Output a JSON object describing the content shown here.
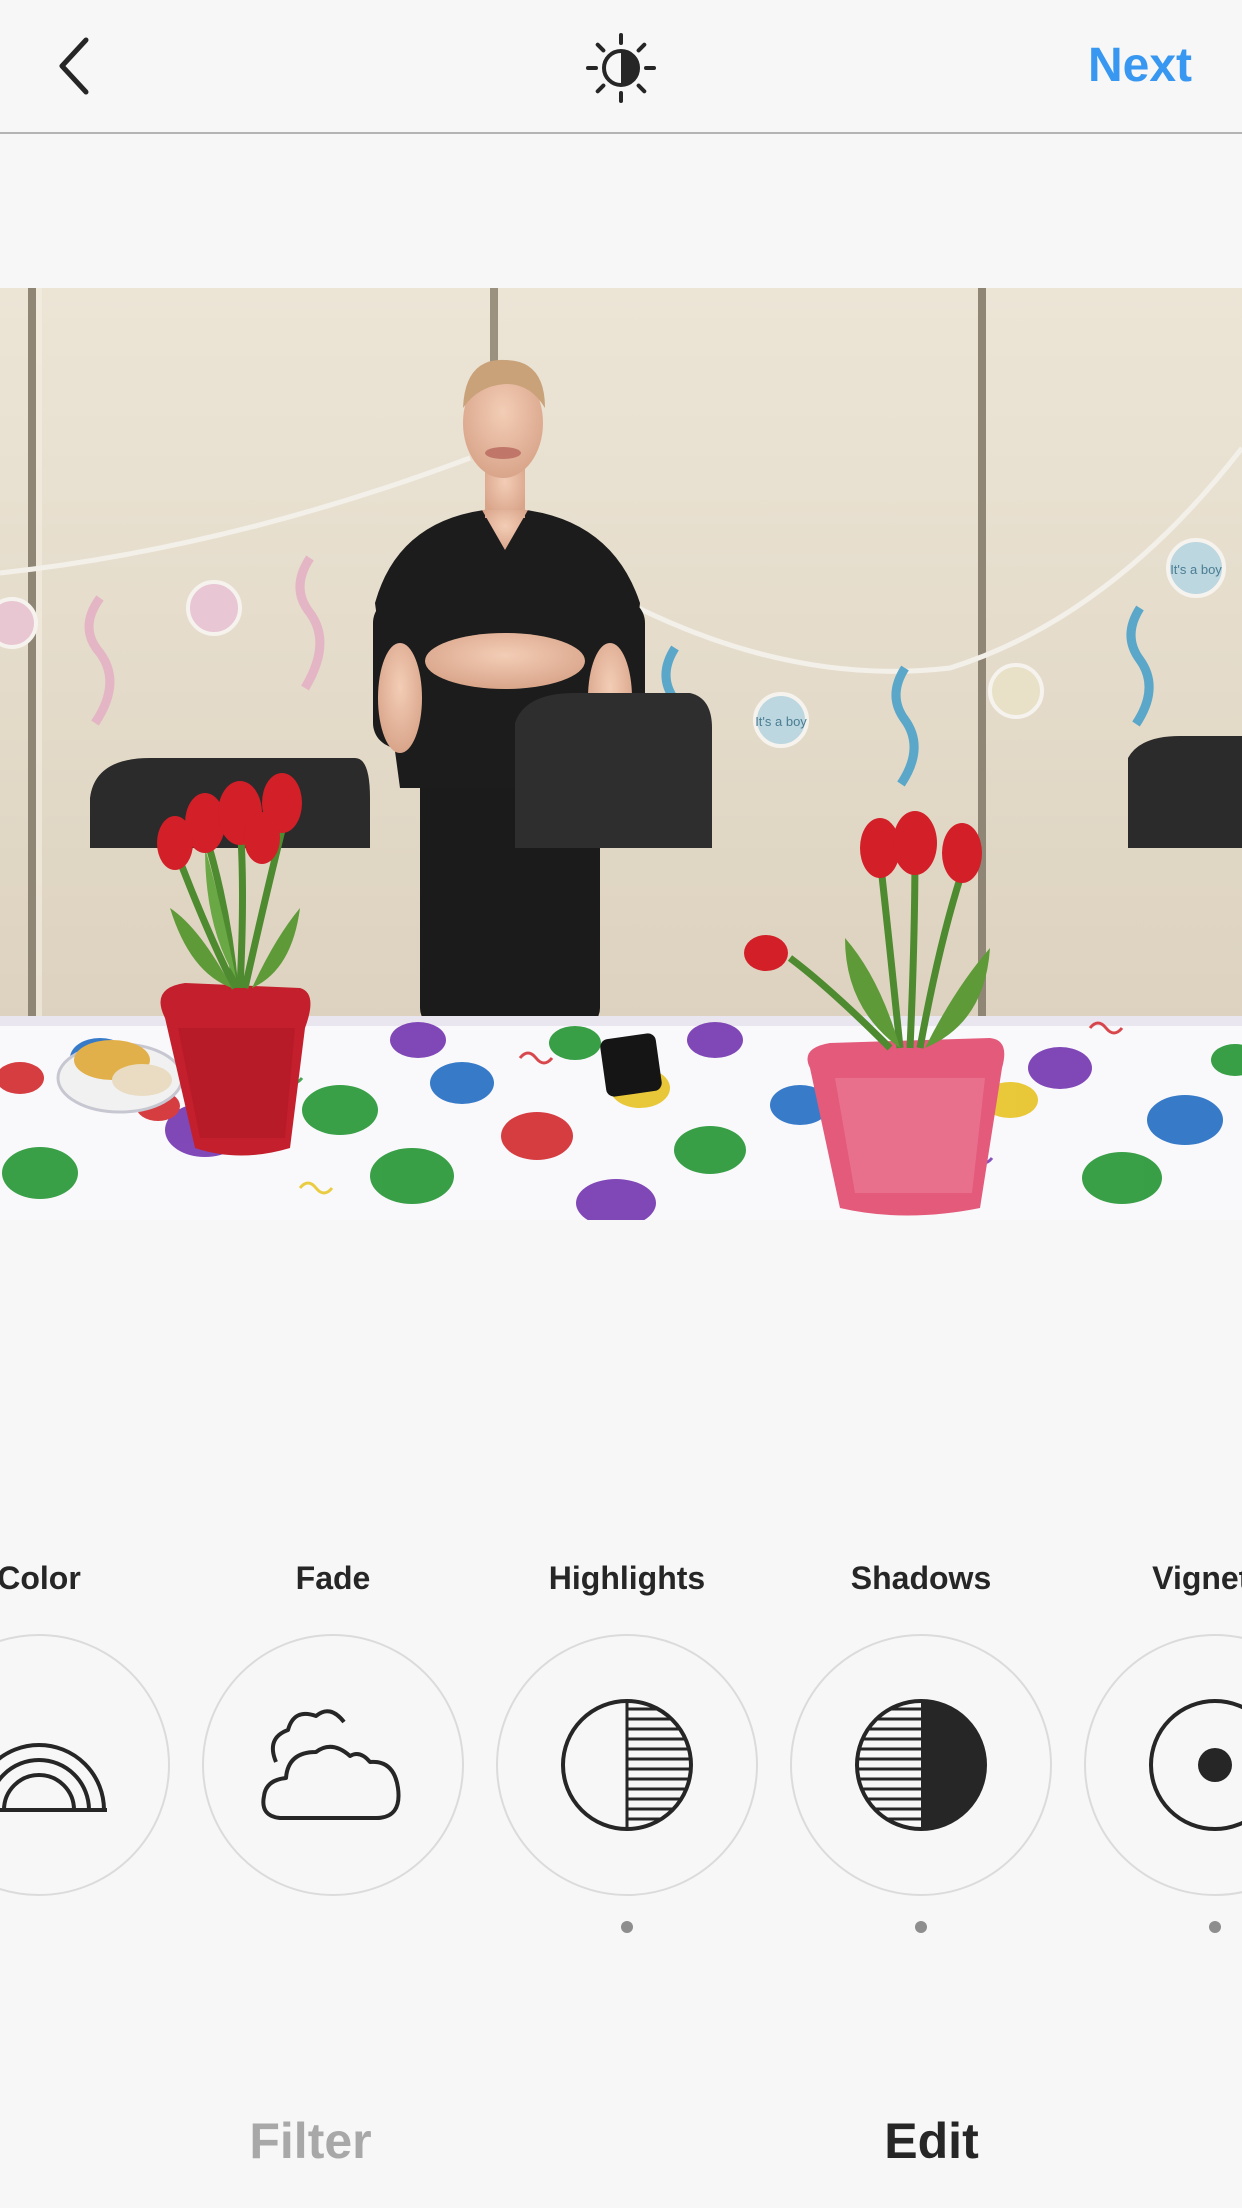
{
  "header": {
    "next_label": "Next",
    "back_icon": "chevron-left-icon",
    "center_icon": "brightness-icon"
  },
  "photo": {
    "banner_text_1": "It's a boy",
    "banner_text_2": "It's a boy"
  },
  "tools": [
    {
      "label": "Color",
      "icon": "rainbow-icon",
      "has_dot": false
    },
    {
      "label": "Fade",
      "icon": "cloud-icon",
      "has_dot": false
    },
    {
      "label": "Highlights",
      "icon": "highlights-icon",
      "has_dot": true
    },
    {
      "label": "Shadows",
      "icon": "shadows-icon",
      "has_dot": true
    },
    {
      "label": "Vignette",
      "icon": "vignette-icon",
      "has_dot": true
    }
  ],
  "tabs": {
    "filter_label": "Filter",
    "edit_label": "Edit",
    "active": "Edit"
  },
  "colors": {
    "accent": "#3897f0",
    "text": "#262626",
    "inactive_tab": "#a8a8a8",
    "background": "#f7f7f7"
  }
}
